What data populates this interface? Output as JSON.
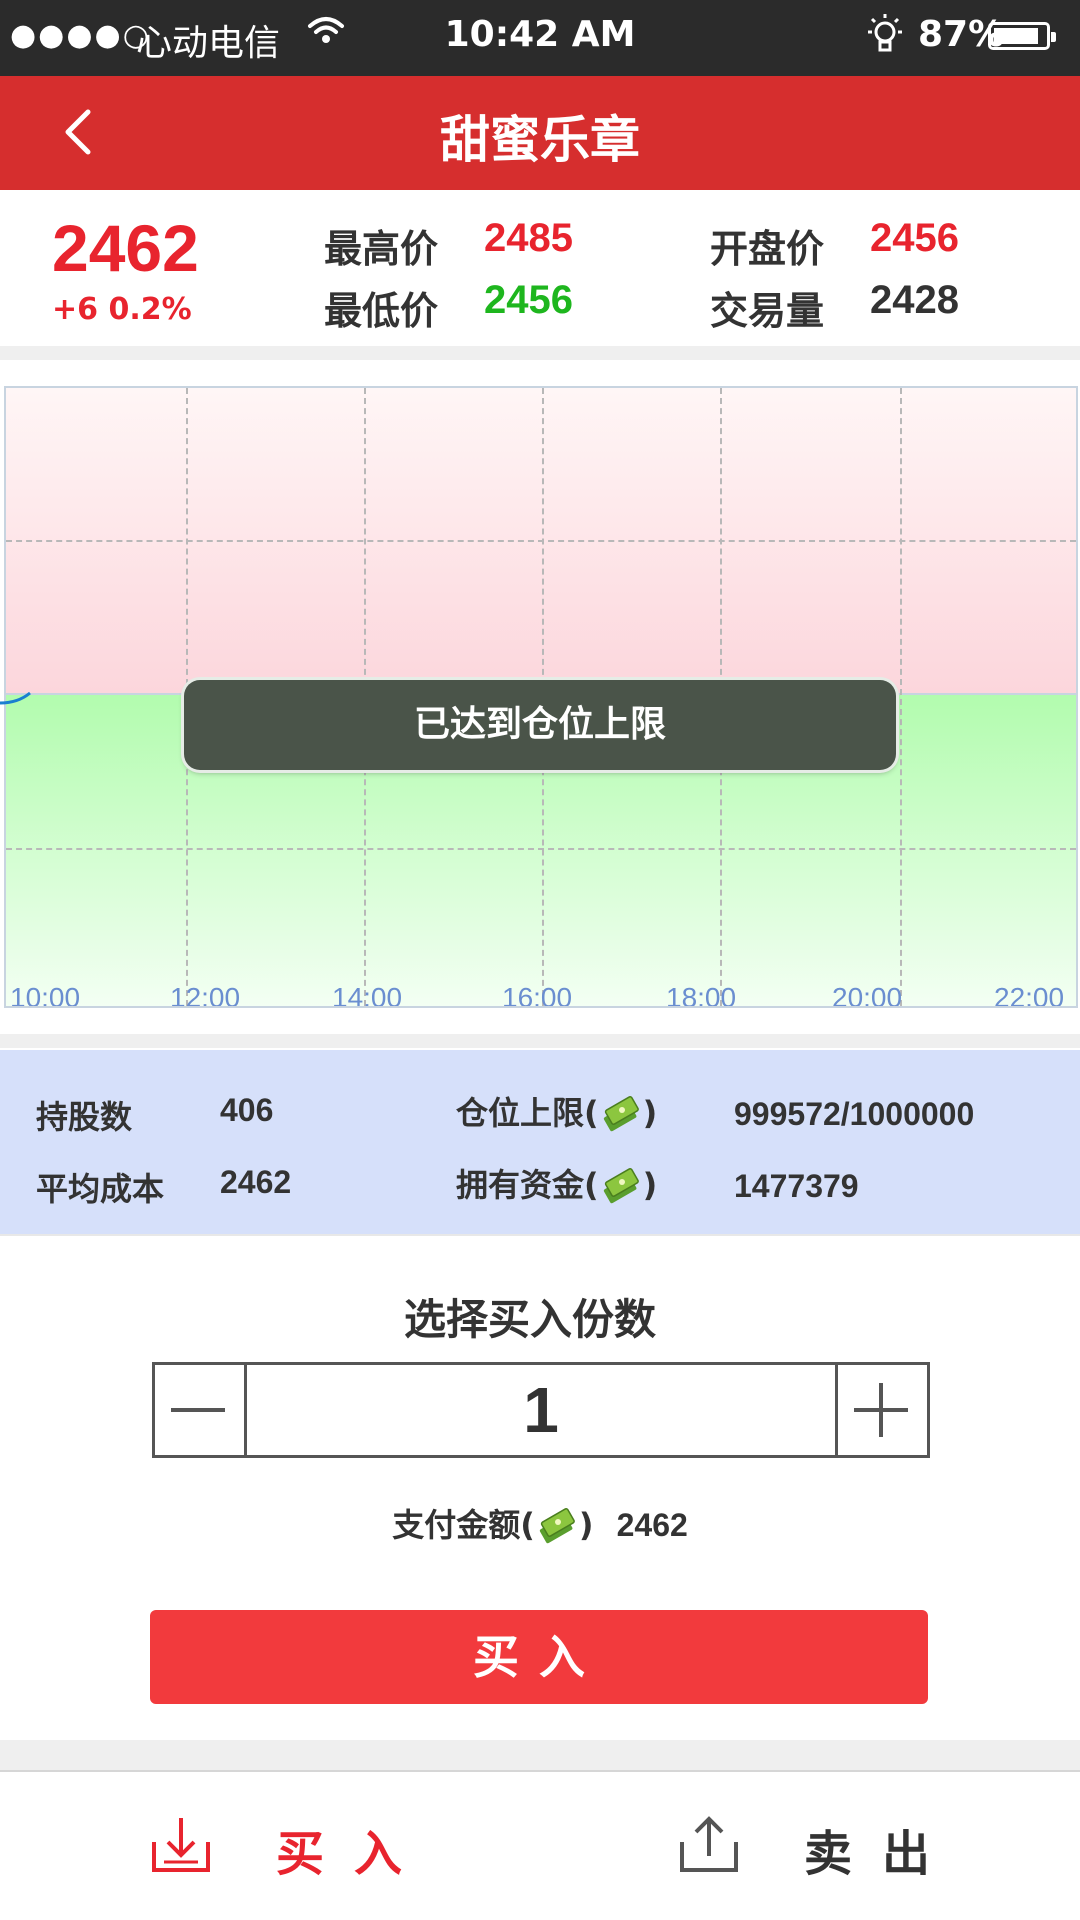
{
  "status_bar": {
    "signal": "●●●●○",
    "carrier": "心动电信",
    "time": "10:42 AM",
    "battery": "87%",
    "battery_level": 0.87
  },
  "header": {
    "title": "甜蜜乐章"
  },
  "quote": {
    "price": "2462",
    "change": "+6  0.2%",
    "high_label": "最高价",
    "high_value": "2485",
    "low_label": "最低价",
    "low_value": "2456",
    "open_label": "开盘价",
    "open_value": "2456",
    "volume_label": "交易量",
    "volume_value": "2428"
  },
  "chart": {
    "x_ticks": [
      "10:00",
      "12:00",
      "14:00",
      "16:00",
      "18:00",
      "20:00",
      "22:00"
    ]
  },
  "toast": "已达到仓位上限",
  "holdings": {
    "shares_label": "持股数",
    "shares_value": "406",
    "avg_cost_label": "平均成本",
    "avg_cost_value": "2462",
    "limit_label_pre": "仓位上限(",
    "limit_label_post": ")",
    "limit_value": "999572/1000000",
    "funds_label_pre": "拥有资金(",
    "funds_label_post": ")",
    "funds_value": "1477379"
  },
  "buy": {
    "title": "选择买入份数",
    "quantity": "1",
    "pay_label_pre": "支付金额(",
    "pay_label_post": ")",
    "pay_value": "2462",
    "submit_label": "买入"
  },
  "tabs": {
    "buy_label": "买入",
    "sell_label": "卖出"
  },
  "colors": {
    "header": "#d62e2e",
    "up": "#e8242e",
    "down": "#1eb61e",
    "button": "#f23a3d",
    "holdings_bg": "#d6e0fa"
  }
}
